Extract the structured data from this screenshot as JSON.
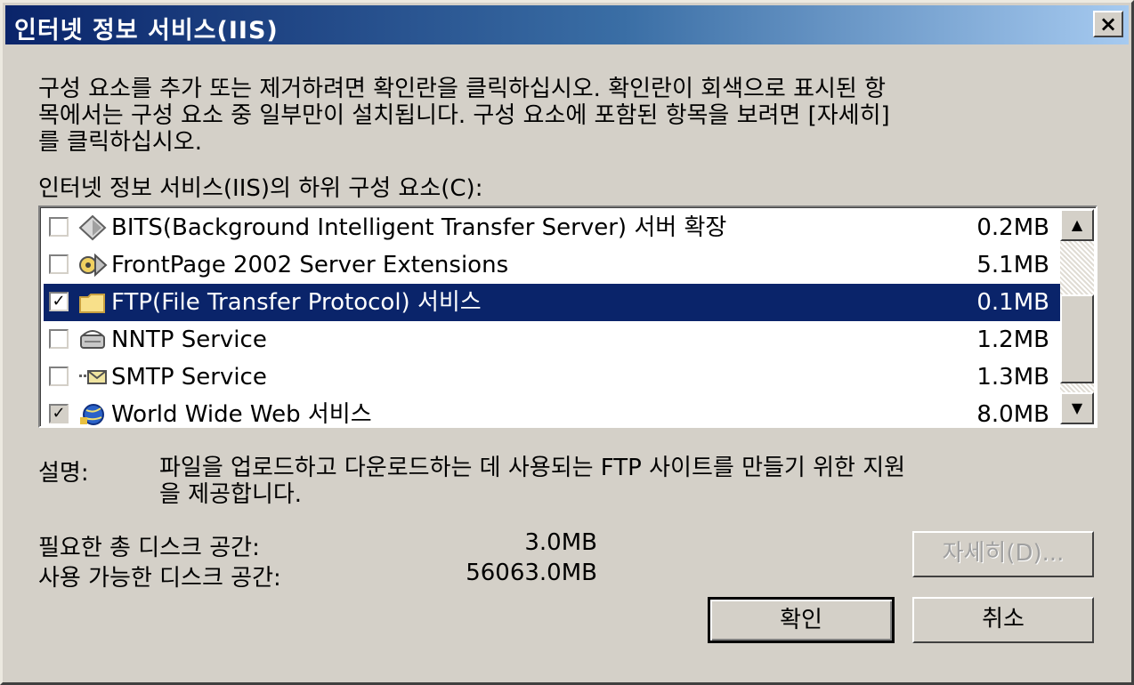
{
  "window": {
    "title": "인터넷 정보 서비스(IIS)",
    "close_label": "×"
  },
  "intro": {
    "line1": "구성 요소를 추가 또는 제거하려면 확인란을 클릭하십시오. 확인란이 회색으로 표시된 항",
    "line2": "목에서는 구성 요소 중 일부만이 설치됩니다. 구성 요소에 포함된 항목을 보려면 [자세히]",
    "line3": "를 클릭하십시오."
  },
  "list": {
    "label": "인터넷 정보 서비스(IIS)의 하위 구성 요소(C):",
    "items": [
      {
        "name": "BITS(Background Intelligent Transfer Server) 서버 확장",
        "size": "0.2MB",
        "checked": false,
        "selected": false,
        "icon": "bits-diamond-icon"
      },
      {
        "name": "FrontPage 2002 Server Extensions",
        "size": "5.1MB",
        "checked": false,
        "selected": false,
        "icon": "frontpage-icon"
      },
      {
        "name": "FTP(File Transfer Protocol) 서비스",
        "size": "0.1MB",
        "checked": true,
        "selected": true,
        "icon": "folder-icon"
      },
      {
        "name": "NNTP Service",
        "size": "1.2MB",
        "checked": false,
        "selected": false,
        "icon": "nntp-icon"
      },
      {
        "name": "SMTP Service",
        "size": "1.3MB",
        "checked": false,
        "selected": false,
        "icon": "smtp-mail-icon"
      },
      {
        "name": "World Wide Web 서비스",
        "size": "8.0MB",
        "checked": true,
        "selected": false,
        "icon": "web-globe-icon"
      }
    ],
    "scroll_up": "▲",
    "scroll_down": "▼"
  },
  "description": {
    "label": "설명:",
    "line1": "파일을 업로드하고 다운로드하는 데 사용되는 FTP 사이트를 만들기 위한 지원",
    "line2": "을 제공합니다."
  },
  "disk": {
    "required_label": "필요한 총 디스크 공간:",
    "required_value": "3.0MB",
    "available_label": "사용 가능한 디스크 공간:",
    "available_value": "56063.0MB"
  },
  "buttons": {
    "details": "자세히(D)...",
    "ok": "확인",
    "cancel": "취소"
  },
  "colors": {
    "title_bar": "#0a246a",
    "selection": "#0a246a",
    "face": "#d4d0c8"
  }
}
